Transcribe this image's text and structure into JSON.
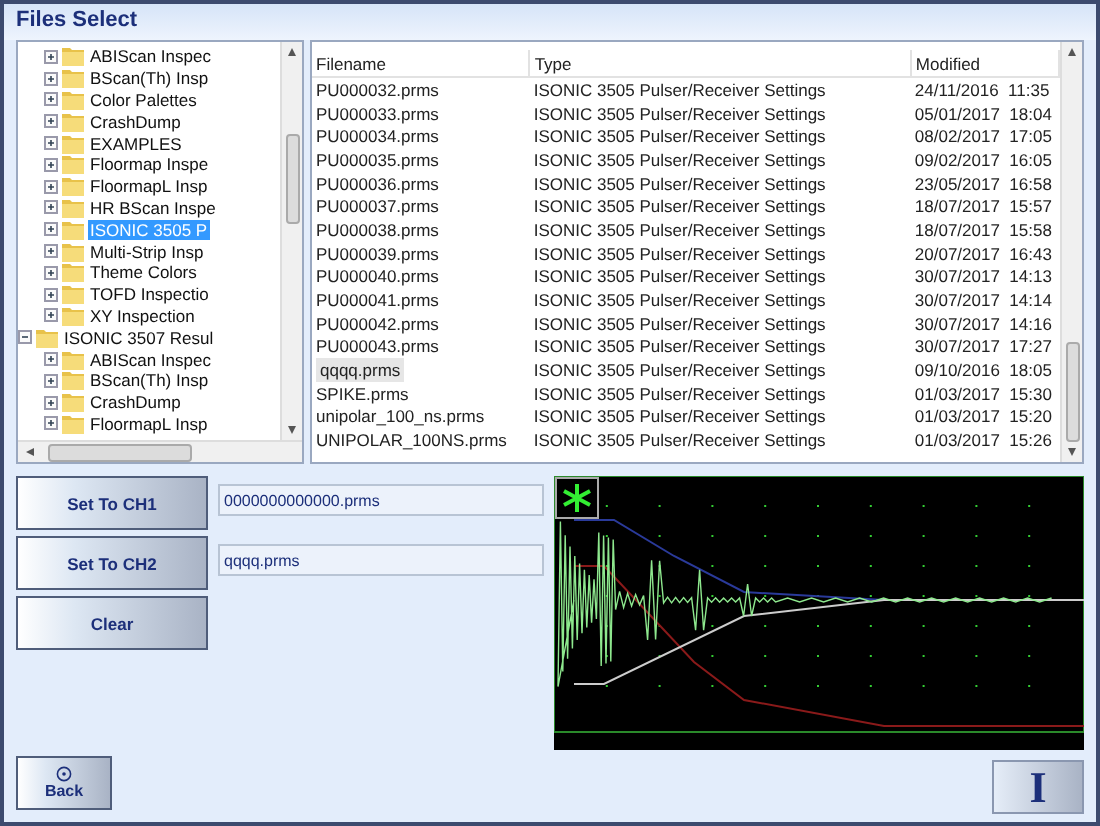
{
  "window": {
    "title": "Files Select"
  },
  "tree": {
    "items": [
      {
        "children": [
          {
            "label": "ABIScan Inspec",
            "expanded": false,
            "selected": false
          },
          {
            "label": "BScan(Th) Insp",
            "expanded": false,
            "selected": false
          },
          {
            "label": "Color Palettes",
            "expanded": false,
            "selected": false
          },
          {
            "label": "CrashDump",
            "expanded": false,
            "selected": false
          },
          {
            "label": "EXAMPLES",
            "expanded": false,
            "selected": false
          },
          {
            "label": "Floormap Inspe",
            "expanded": false,
            "selected": false
          },
          {
            "label": "FloormapL Insp",
            "expanded": false,
            "selected": false
          },
          {
            "label": "HR BScan Inspe",
            "expanded": false,
            "selected": false
          },
          {
            "label": "ISONIC 3505 P",
            "expanded": false,
            "selected": true
          },
          {
            "label": "Multi-Strip Insp",
            "expanded": false,
            "selected": false
          },
          {
            "label": "Theme Colors",
            "expanded": false,
            "selected": false
          },
          {
            "label": "TOFD Inspectio",
            "expanded": false,
            "selected": false
          },
          {
            "label": "XY Inspection",
            "expanded": false,
            "selected": false
          }
        ]
      },
      {
        "label": "ISONIC 3507 Resul",
        "expanded": true,
        "selected": false,
        "children": [
          {
            "label": "ABIScan Inspec",
            "expanded": false,
            "selected": false
          },
          {
            "label": "BScan(Th) Insp",
            "expanded": false,
            "selected": false
          },
          {
            "label": "CrashDump",
            "expanded": false,
            "selected": false
          },
          {
            "label": "FloormapL Insp",
            "expanded": false,
            "selected": false
          }
        ]
      }
    ]
  },
  "files": {
    "columns": [
      "Filename",
      "Type",
      "Modified"
    ],
    "rows": [
      {
        "name": "PU000032.prms",
        "type": "ISONIC 3505 Pulser/Receiver Settings",
        "modified": "24/11/2016  11:35",
        "selected": false
      },
      {
        "name": "PU000033.prms",
        "type": "ISONIC 3505 Pulser/Receiver Settings",
        "modified": "05/01/2017  18:04",
        "selected": false
      },
      {
        "name": "PU000034.prms",
        "type": "ISONIC 3505 Pulser/Receiver Settings",
        "modified": "08/02/2017  17:05",
        "selected": false
      },
      {
        "name": "PU000035.prms",
        "type": "ISONIC 3505 Pulser/Receiver Settings",
        "modified": "09/02/2017  16:05",
        "selected": false
      },
      {
        "name": "PU000036.prms",
        "type": "ISONIC 3505 Pulser/Receiver Settings",
        "modified": "23/05/2017  16:58",
        "selected": false
      },
      {
        "name": "PU000037.prms",
        "type": "ISONIC 3505 Pulser/Receiver Settings",
        "modified": "18/07/2017  15:57",
        "selected": false
      },
      {
        "name": "PU000038.prms",
        "type": "ISONIC 3505 Pulser/Receiver Settings",
        "modified": "18/07/2017  15:58",
        "selected": false
      },
      {
        "name": "PU000039.prms",
        "type": "ISONIC 3505 Pulser/Receiver Settings",
        "modified": "20/07/2017  16:43",
        "selected": false
      },
      {
        "name": "PU000040.prms",
        "type": "ISONIC 3505 Pulser/Receiver Settings",
        "modified": "30/07/2017  14:13",
        "selected": false
      },
      {
        "name": "PU000041.prms",
        "type": "ISONIC 3505 Pulser/Receiver Settings",
        "modified": "30/07/2017  14:14",
        "selected": false
      },
      {
        "name": "PU000042.prms",
        "type": "ISONIC 3505 Pulser/Receiver Settings",
        "modified": "30/07/2017  14:16",
        "selected": false
      },
      {
        "name": "PU000043.prms",
        "type": "ISONIC 3505 Pulser/Receiver Settings",
        "modified": "30/07/2017  17:27",
        "selected": false
      },
      {
        "name": "qqqq.prms",
        "type": "ISONIC 3505 Pulser/Receiver Settings",
        "modified": "09/10/2016  18:05",
        "selected": true
      },
      {
        "name": "SPIKE.prms",
        "type": "ISONIC 3505 Pulser/Receiver Settings",
        "modified": "01/03/2017  15:30",
        "selected": false
      },
      {
        "name": "unipolar_100_ns.prms",
        "type": "ISONIC 3505 Pulser/Receiver Settings",
        "modified": "01/03/2017  15:20",
        "selected": false
      },
      {
        "name": "UNIPOLAR_100NS.prms",
        "type": "ISONIC 3505 Pulser/Receiver Settings",
        "modified": "01/03/2017  15:26",
        "selected": false
      }
    ]
  },
  "channels": [
    {
      "button": "Set To CH1",
      "value": "0000000000000.prms"
    },
    {
      "button": "Set To CH2",
      "value": "qqqq.prms"
    }
  ],
  "clear_button": "Clear",
  "back_button": "Back",
  "info_button": "I"
}
